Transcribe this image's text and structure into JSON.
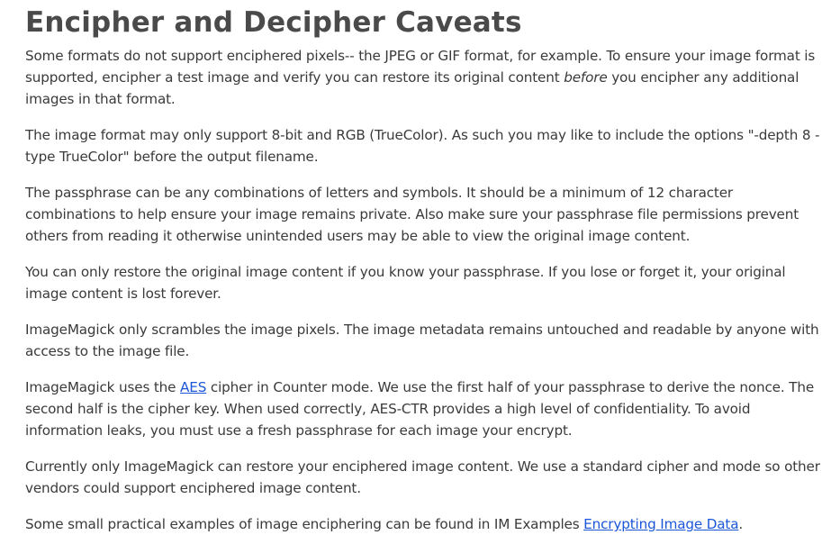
{
  "heading": "Encipher and Decipher Caveats",
  "paragraphs": {
    "p1": {
      "before": "Some formats do not support enciphered pixels-- the JPEG or GIF format, for example. To ensure your image format is supported, encipher a test image and verify you can restore its original content ",
      "emphasis": "before",
      "after": " you encipher any additional images in that format."
    },
    "p2": "The image format may only support 8-bit and RGB (TrueColor). As such you may like to include the options \"-depth 8 -type TrueColor\" before the output filename.",
    "p3": "The passphrase can be any combinations of letters and symbols. It should be a minimum of 12 character combinations to help ensure your image remains private. Also make sure your passphrase file permissions prevent others from reading it otherwise unintended users may be able to view the original image content.",
    "p4": "You can only restore the original image content if you know your passphrase. If you lose or forget it, your original image content is lost forever.",
    "p5": "ImageMagick only scrambles the image pixels. The image metadata remains untouched and readable by anyone with access to the image file.",
    "p6": {
      "before": "ImageMagick uses the ",
      "link": "AES",
      "after": " cipher in Counter mode. We use the first half of your passphrase to derive the nonce. The second half is the cipher key. When used correctly, AES-CTR provides a high level of confidentiality. To avoid information leaks, you must use a fresh passphrase for each image your encrypt."
    },
    "p7": "Currently only ImageMagick can restore your enciphered image content. We use a standard cipher and mode so other vendors could support enciphered image content.",
    "p8": {
      "before": "Some small practical examples of image enciphering can be found in IM Examples ",
      "link": "Encrypting Image Data",
      "after": "."
    }
  },
  "colors": {
    "text": "#3a3a3a",
    "heading": "#4a4a4a",
    "link": "#1a56d9",
    "background": "#ffffff"
  }
}
